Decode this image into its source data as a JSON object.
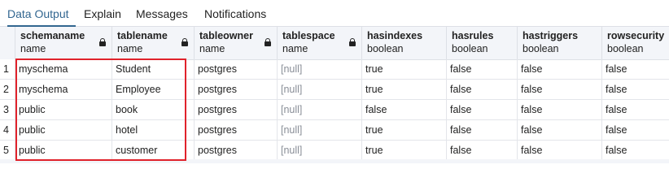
{
  "tabs": [
    {
      "label": "Data Output",
      "active": true
    },
    {
      "label": "Explain",
      "active": false
    },
    {
      "label": "Messages",
      "active": false
    },
    {
      "label": "Notifications",
      "active": false
    }
  ],
  "columns": [
    {
      "name": "schemaname",
      "type": "name",
      "locked": true
    },
    {
      "name": "tablename",
      "type": "name",
      "locked": true
    },
    {
      "name": "tableowner",
      "type": "name",
      "locked": true
    },
    {
      "name": "tablespace",
      "type": "name",
      "locked": true
    },
    {
      "name": "hasindexes",
      "type": "boolean",
      "locked": false
    },
    {
      "name": "hasrules",
      "type": "boolean",
      "locked": false
    },
    {
      "name": "hastriggers",
      "type": "boolean",
      "locked": false
    },
    {
      "name": "rowsecurity",
      "type": "boolean",
      "locked": false
    }
  ],
  "rows": [
    {
      "num": "1",
      "cells": [
        "myschema",
        "Student",
        "postgres",
        "[null]",
        "true",
        "false",
        "false",
        "false"
      ]
    },
    {
      "num": "2",
      "cells": [
        "myschema",
        "Employee",
        "postgres",
        "[null]",
        "true",
        "false",
        "false",
        "false"
      ]
    },
    {
      "num": "3",
      "cells": [
        "public",
        "book",
        "postgres",
        "[null]",
        "false",
        "false",
        "false",
        "false"
      ]
    },
    {
      "num": "4",
      "cells": [
        "public",
        "hotel",
        "postgres",
        "[null]",
        "true",
        "false",
        "false",
        "false"
      ]
    },
    {
      "num": "5",
      "cells": [
        "public",
        "customer",
        "postgres",
        "[null]",
        "true",
        "false",
        "false",
        "false"
      ]
    }
  ],
  "colors": {
    "active_tab": "#326690",
    "highlight_border": "#e0222b",
    "null_text": "#8a8f98",
    "header_bg": "#f3f5f9"
  }
}
